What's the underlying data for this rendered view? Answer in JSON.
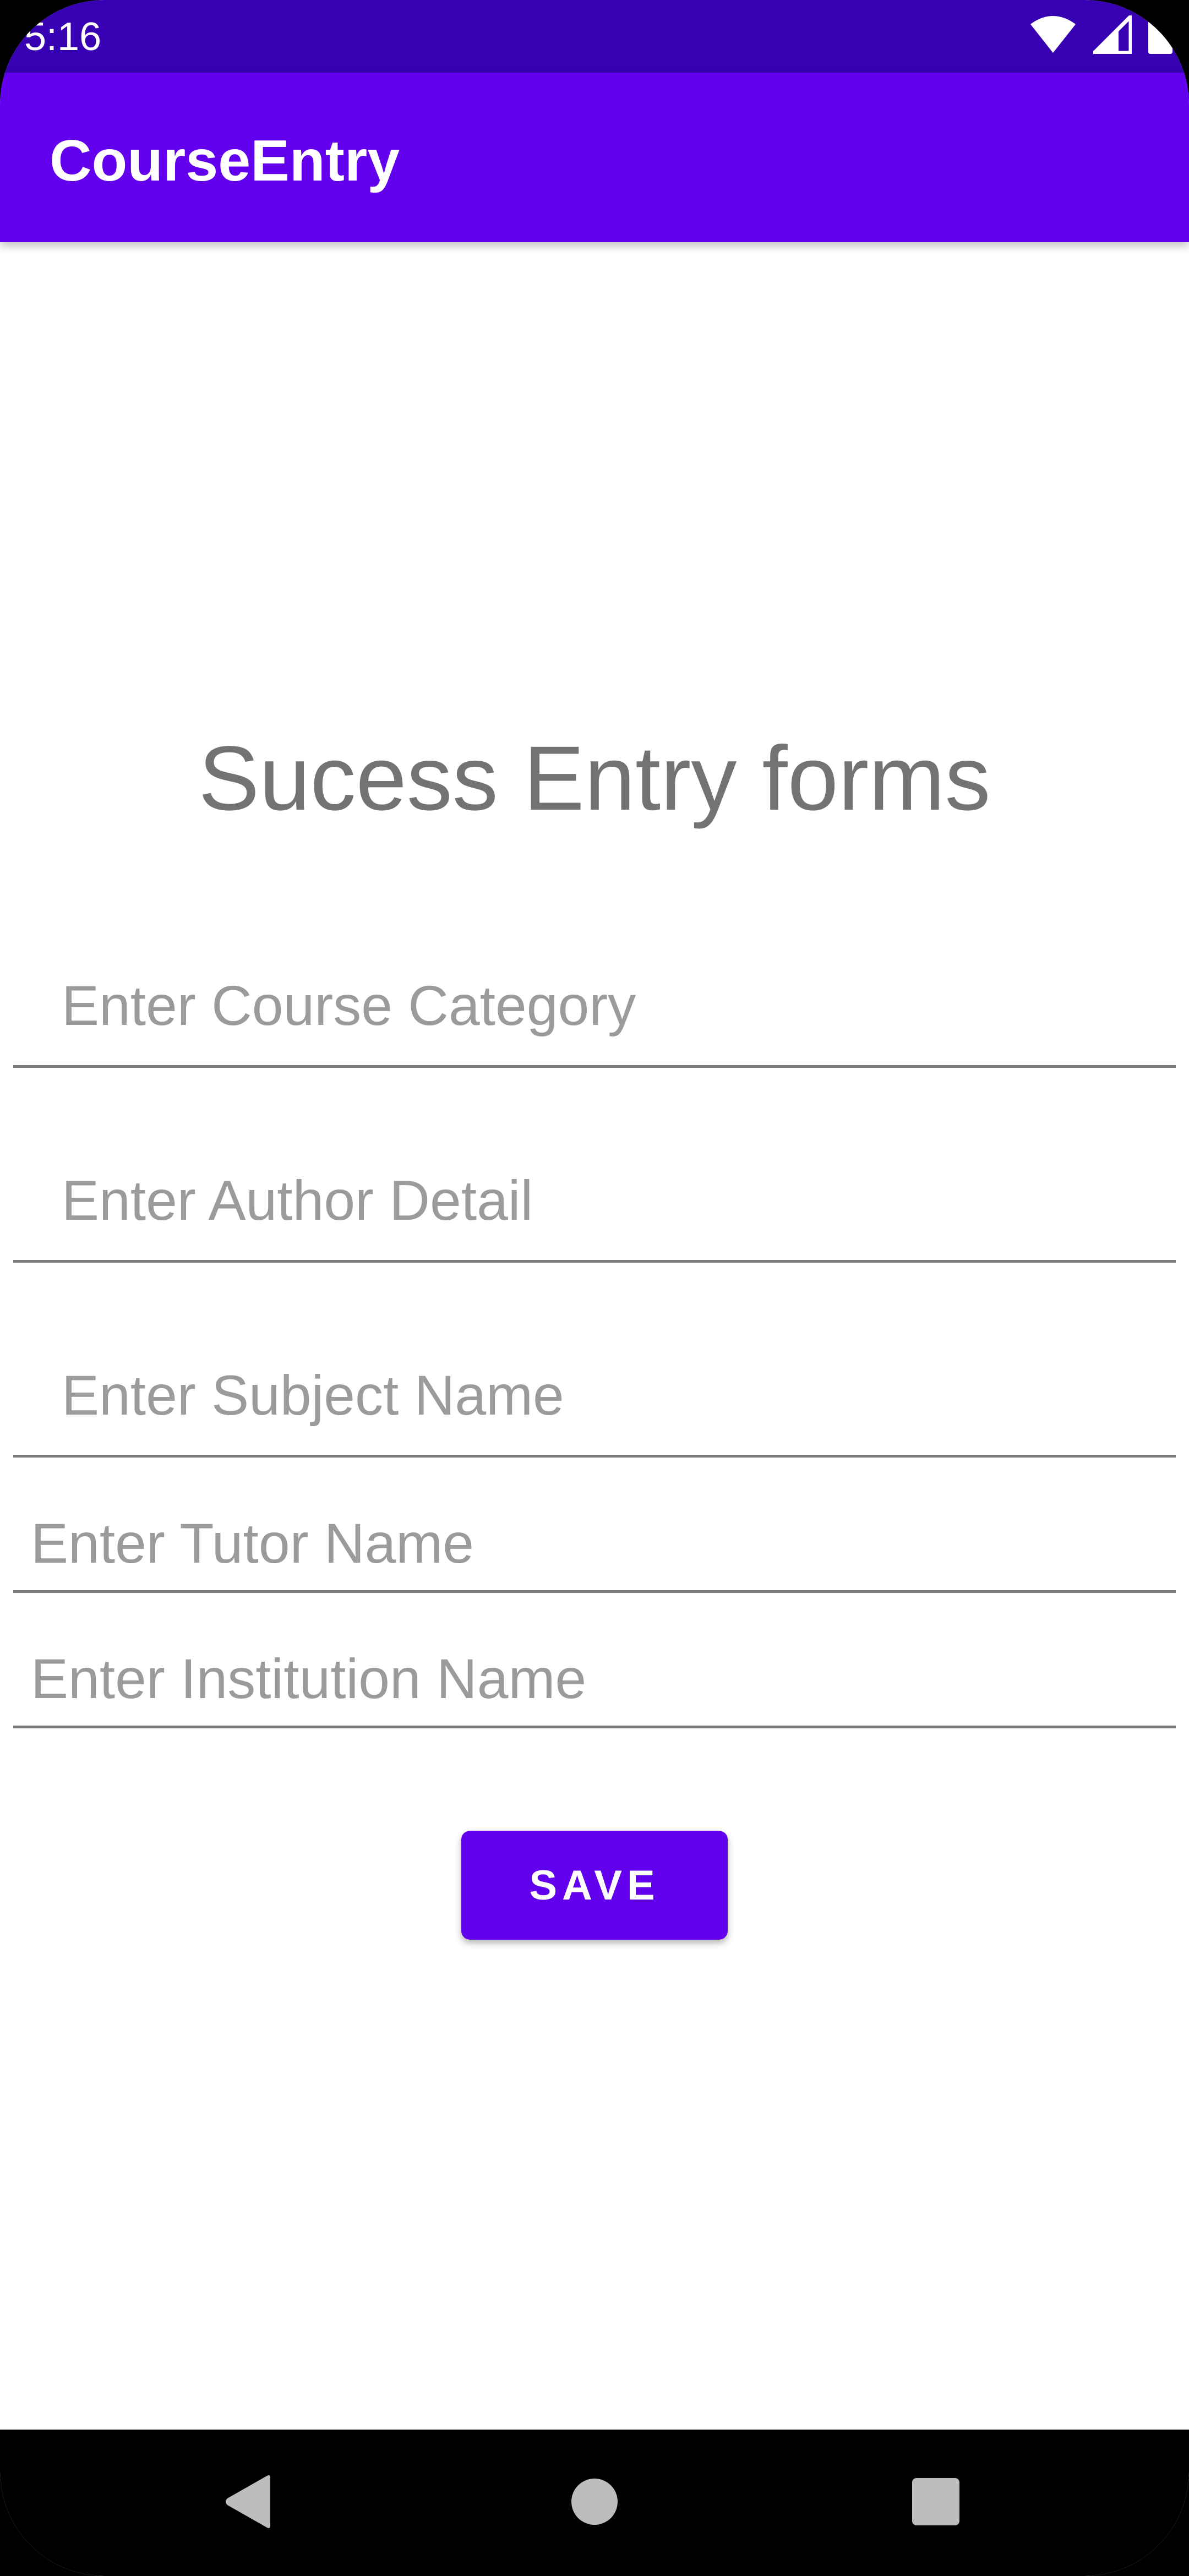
{
  "status_bar": {
    "time": "5:16",
    "icons": [
      "wifi-icon",
      "signal-icon",
      "battery-icon"
    ]
  },
  "app_bar": {
    "title": "CourseEntry",
    "color": "#6200EE",
    "status_color": "#3700B3"
  },
  "main": {
    "heading": "Sucess Entry forms",
    "fields": [
      {
        "placeholder": "Enter Course Category",
        "value": ""
      },
      {
        "placeholder": "Enter Author Detail",
        "value": ""
      },
      {
        "placeholder": "Enter Subject Name",
        "value": ""
      },
      {
        "placeholder": "Enter Tutor Name",
        "value": ""
      },
      {
        "placeholder": "Enter Institution Name",
        "value": ""
      }
    ],
    "save_label": "SAVE"
  },
  "nav_bar": {
    "buttons": [
      "back-icon",
      "home-icon",
      "recents-icon"
    ]
  }
}
